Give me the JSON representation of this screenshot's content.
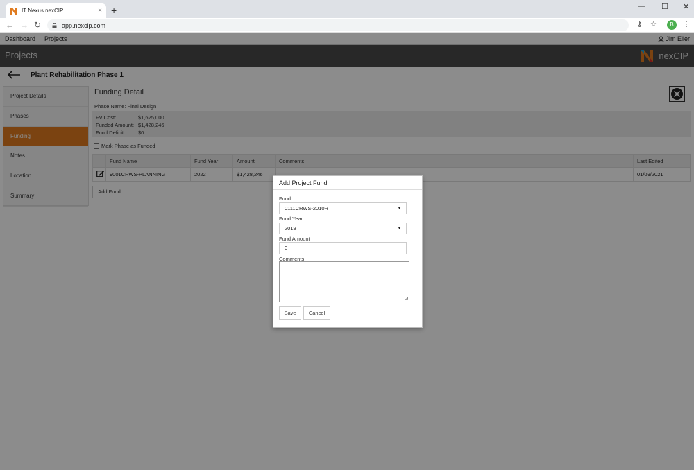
{
  "browser": {
    "tab_title": "IT Nexus nexCIP",
    "tab_close": "×",
    "new_tab": "+",
    "url": "app.nexcip.com",
    "profile_initial": "B",
    "window_controls": [
      "—",
      "☐",
      "✕"
    ]
  },
  "app_nav": {
    "items": [
      {
        "label": "Dashboard"
      },
      {
        "label": "Projects"
      }
    ],
    "user": "Jim Eiler"
  },
  "header": {
    "title": "Projects",
    "brand": "nexCIP"
  },
  "page": {
    "title": "Plant Rehabilitation Phase 1"
  },
  "sidebar": {
    "items": [
      {
        "label": "Project Details"
      },
      {
        "label": "Phases"
      },
      {
        "label": "Funding"
      },
      {
        "label": "Notes"
      },
      {
        "label": "Location"
      },
      {
        "label": "Summary"
      }
    ],
    "active": "Funding"
  },
  "funding": {
    "title": "Funding Detail",
    "phase_name": "Phase Name: Final Design",
    "fv_cost_label": "FV Cost:",
    "fv_cost": "$1,625,000",
    "funded_label": "Funded Amount:",
    "funded": "$1,428,246",
    "deficit_label": "Fund Deficit:",
    "deficit": "$0",
    "mark_label": "Mark Phase as Funded",
    "add_fund": "Add Fund",
    "columns": [
      "Fund Name",
      "Fund Year",
      "Amount",
      "Comments",
      "Last Edited"
    ],
    "rows": [
      {
        "fund_name": "9001CRWS-PLANNING",
        "fund_year": "2022",
        "amount": "$1,428,246",
        "comments": "",
        "last_edited": "01/09/2021"
      }
    ]
  },
  "modal": {
    "title": "Add Project Fund",
    "fund_label": "Fund",
    "fund_value": "0111CRWS-2010R",
    "year_label": "Fund Year",
    "year_value": "2019",
    "amount_label": "Fund Amount",
    "amount_value": "0",
    "comments_label": "Comments",
    "save": "Save",
    "cancel": "Cancel"
  },
  "colors": {
    "accent": "#e07b20",
    "header_bg": "#4a4a4a"
  }
}
